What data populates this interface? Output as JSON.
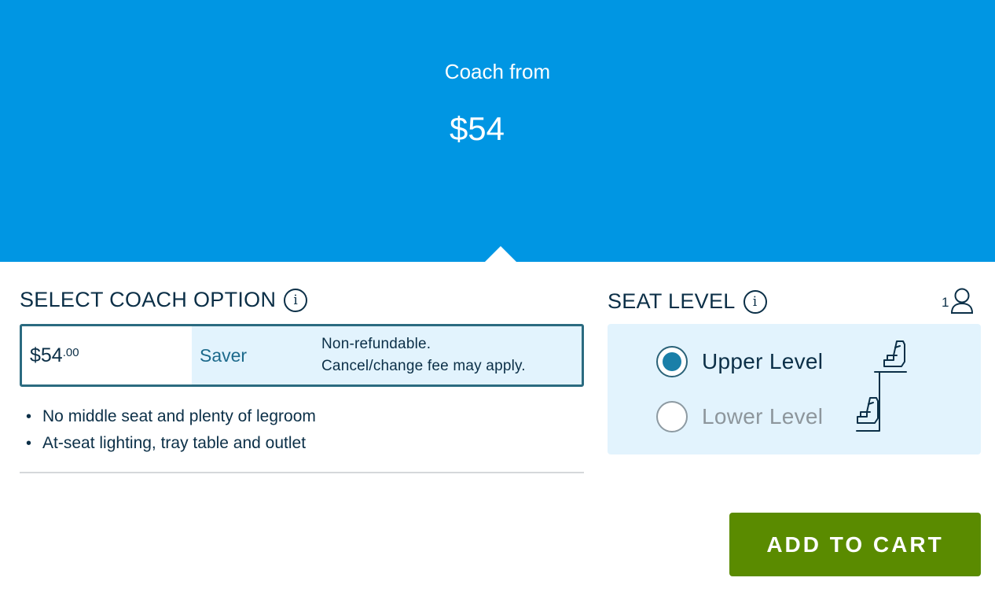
{
  "banner": {
    "label": "Coach from",
    "price": "$54"
  },
  "coach": {
    "heading": "SELECT COACH OPTION",
    "info_icon": "info-icon",
    "option": {
      "price_main": "$54",
      "price_cents": ".00",
      "name": "Saver",
      "terms_line1": "Non-refundable.",
      "terms_line2": "Cancel/change fee may apply."
    },
    "features": [
      "No middle seat and plenty of legroom",
      "At-seat lighting, tray table and outlet"
    ]
  },
  "seat": {
    "heading": "SEAT LEVEL",
    "info_icon": "info-icon",
    "passenger_count": "1",
    "passenger_icon": "person-icon",
    "options": [
      {
        "label": "Upper Level",
        "selected": true
      },
      {
        "label": "Lower Level",
        "selected": false
      }
    ],
    "diagram_icon": "bilevel-seat-icon"
  },
  "actions": {
    "add_to_cart": "ADD TO CART"
  },
  "colors": {
    "banner": "#0096e3",
    "panel": "#e2f3fd",
    "primary_text": "#0b2f47",
    "button": "#5a8b00",
    "selected_border": "#2b6b80"
  }
}
